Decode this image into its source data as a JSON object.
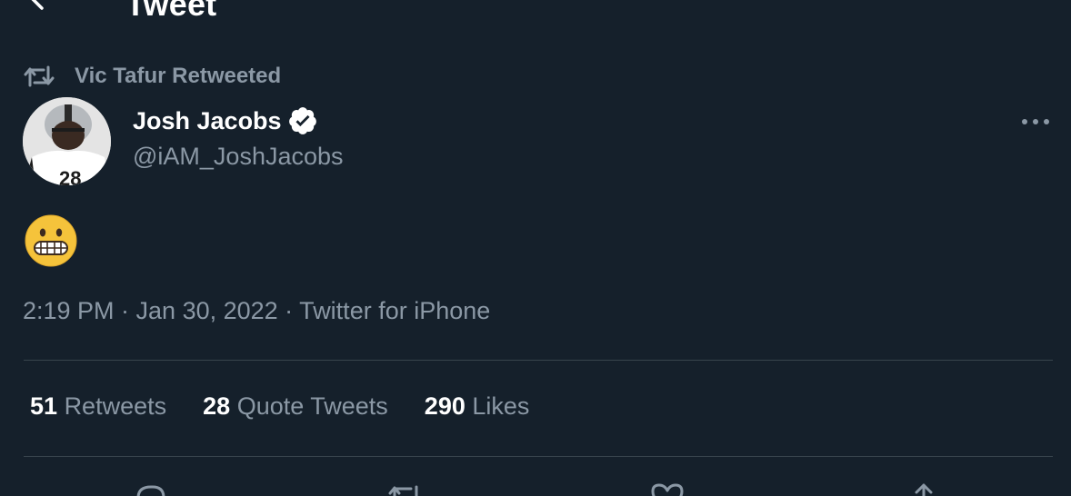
{
  "header": {
    "title": "Tweet",
    "back_icon": "arrow-left-icon"
  },
  "retweet_context": {
    "icon": "retweet-icon",
    "text": "Vic Tafur Retweeted"
  },
  "tweet": {
    "author_name": "Josh Jacobs",
    "verified": true,
    "author_handle": "@iAM_JoshJacobs",
    "body_emoji": "😬",
    "meta": "2:19 PM · Jan 30, 2022 · Twitter for iPhone"
  },
  "stats": {
    "retweets_count": "51",
    "retweets_label": "Retweets",
    "quote_tweets_count": "28",
    "quote_tweets_label": "Quote Tweets",
    "likes_count": "290",
    "likes_label": "Likes"
  },
  "actions": [
    "reply-icon",
    "retweet-icon",
    "like-icon",
    "share-icon"
  ],
  "colors": {
    "background": "#15202b",
    "text_primary": "#ffffff",
    "text_secondary": "#8b98a5",
    "divider": "#38444d"
  }
}
